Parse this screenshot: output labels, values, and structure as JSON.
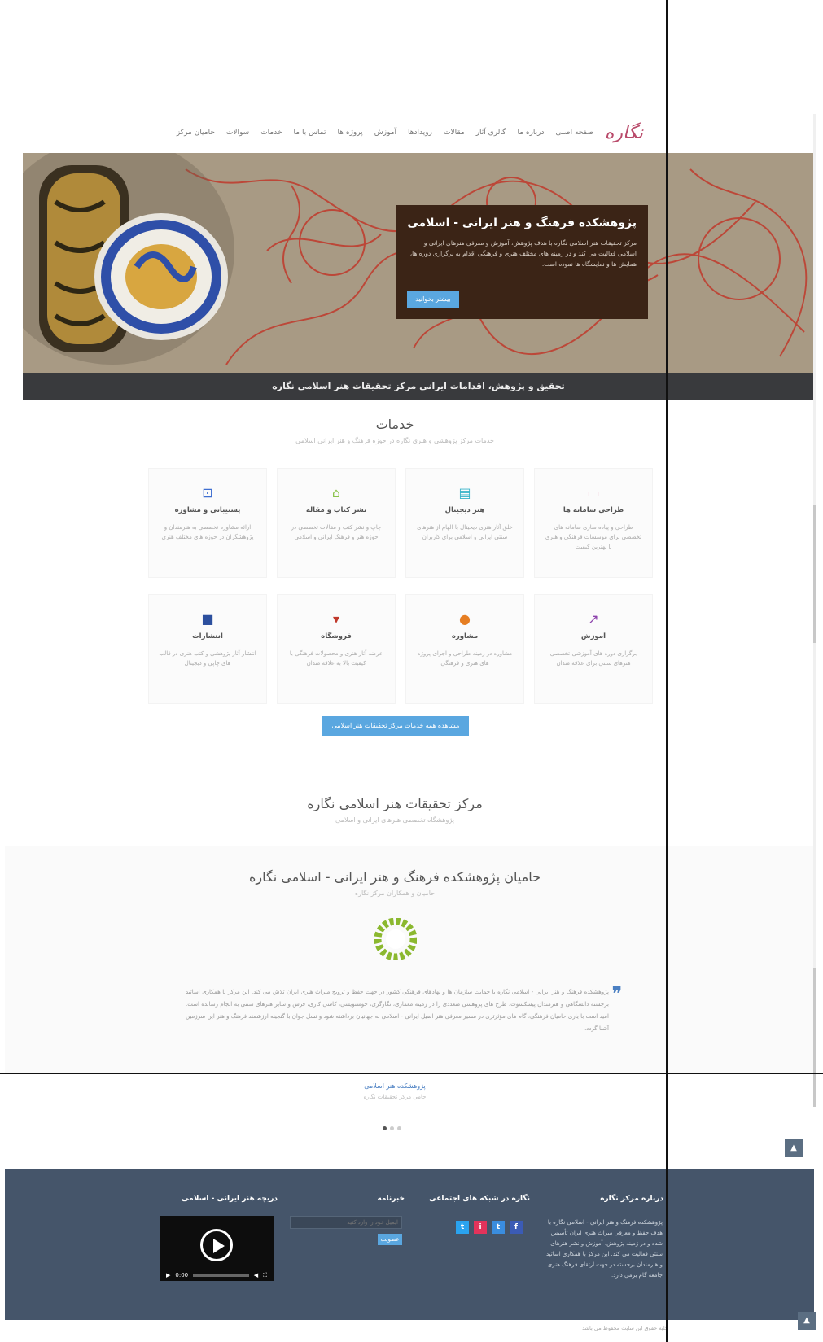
{
  "nav": {
    "logo": "نگاره",
    "items": [
      "صفحه اصلی",
      "درباره ما",
      "گالری آثار",
      "مقالات",
      "رویدادها",
      "آموزش",
      "پروژه ها",
      "تماس با ما",
      "خدمات",
      "سوالات",
      "حامیان مرکز"
    ]
  },
  "hero": {
    "title": "پژوهشکده فرهنگ و هنر ایرانی - اسلامی",
    "body": "مرکز تحقیقات هنر اسلامی نگاره با هدف پژوهش، آموزش و معرفی هنرهای ایرانی و اسلامی فعالیت می کند و در زمینه های مختلف هنری و فرهنگی اقدام به برگزاری دوره ها، همایش ها و نمایشگاه ها نموده است.",
    "button": "بیشتر بخوانید",
    "strip": "تحقیق و پژوهش، اقدامات ایرانی مرکز تحقیقات هنر اسلامی نگاره"
  },
  "services": {
    "title": "خدمات",
    "subtitle": "خدمات مرکز پژوهشی و هنری نگاره در حوزه فرهنگ و هنر ایرانی اسلامی",
    "items": [
      {
        "icon": "laptop-icon",
        "title": "طراحی سامانه ها",
        "desc": "طراحی و پیاده سازی سامانه های تخصصی برای موسسات فرهنگی و هنری با بهترین کیفیت"
      },
      {
        "icon": "screen-icon",
        "title": "هنر دیجیتال",
        "desc": "خلق آثار هنری دیجیتال با الهام از هنرهای سنتی ایرانی و اسلامی برای کاربران"
      },
      {
        "icon": "leaf-icon",
        "title": "نشر کتاب و مقاله",
        "desc": "چاپ و نشر کتب و مقالات تخصصی در حوزه هنر و فرهنگ ایرانی و اسلامی"
      },
      {
        "icon": "frame-icon",
        "title": "پشتیبانی و مشاوره",
        "desc": "ارائه مشاوره تخصصی به هنرمندان و پژوهشگران در حوزه های مختلف هنری"
      },
      {
        "icon": "chart-icon",
        "title": "آموزش",
        "desc": "برگزاری دوره های آموزشی تخصصی هنرهای سنتی برای علاقه مندان"
      },
      {
        "icon": "user-icon",
        "title": "مشاوره",
        "desc": "مشاوره در زمینه طراحی و اجرای پروژه های هنری و فرهنگی"
      },
      {
        "icon": "cart-icon",
        "title": "فروشگاه",
        "desc": "عرضه آثار هنری و محصولات فرهنگی با کیفیت بالا به علاقه مندان"
      },
      {
        "icon": "book-icon",
        "title": "انتشارات",
        "desc": "انتشار آثار پژوهشی و کتب هنری در قالب های چاپی و دیجیتال"
      }
    ],
    "more": "مشاهده همه خدمات مرکز تحقیقات هنر اسلامی"
  },
  "center": {
    "title": "مرکز تحقیقات هنر اسلامی نگاره",
    "subtitle": "پژوهشگاه تخصصی هنرهای ایرانی و اسلامی"
  },
  "sponsors": {
    "title": "حامیان پژوهشکده فرهنگ و هنر ایرانی - اسلامی نگاره",
    "subtitle": "حامیان و همکاران مرکز نگاره",
    "quote": "پژوهشکده فرهنگ و هنر ایرانی - اسلامی نگاره با حمایت سازمان ها و نهادهای فرهنگی کشور در جهت حفظ و ترویج میراث هنری ایران تلاش می کند. این مرکز با همکاری اساتید برجسته دانشگاهی و هنرمندان پیشکسوت، طرح های پژوهشی متعددی را در زمینه معماری، نگارگری، خوشنویسی، کاشی کاری، فرش و سایر هنرهای سنتی به انجام رسانده است. امید است با یاری حامیان فرهنگی، گام های مؤثرتری در مسیر معرفی هنر اصیل ایرانی - اسلامی به جهانیان برداشته شود و نسل جوان با گنجینه ارزشمند فرهنگ و هنر این سرزمین آشنا گردد.",
    "name": "پژوهشکده هنر اسلامی",
    "role": "حامی مرکز تحقیقات نگاره"
  },
  "footer": {
    "about_title": "درباره مرکز نگاره",
    "about": "پژوهشکده فرهنگ و هنر ایرانی - اسلامی نگاره با هدف حفظ و معرفی میراث هنری ایران تأسیس شده و در زمینه پژوهش، آموزش و نشر هنرهای سنتی فعالیت می کند. این مرکز با همکاری اساتید و هنرمندان برجسته در جهت ارتقای فرهنگ هنری جامعه گام برمی دارد.",
    "social_title": "نگاره در شبکه های اجتماعی",
    "social": [
      "t",
      "i",
      "t",
      "f"
    ],
    "social_colors": [
      "#2aa3ef",
      "#e2335b",
      "#3a8dde",
      "#3b5bb5"
    ],
    "nl_title": "خبرنامه",
    "nl_placeholder": "ایمیل خود را وارد کنید",
    "nl_button": "عضویت",
    "video_title": "دریچه هنر ایرانی - اسلامی",
    "video_time": "0:00",
    "copyright": "کلیه حقوق این سایت محفوظ می باشد"
  }
}
